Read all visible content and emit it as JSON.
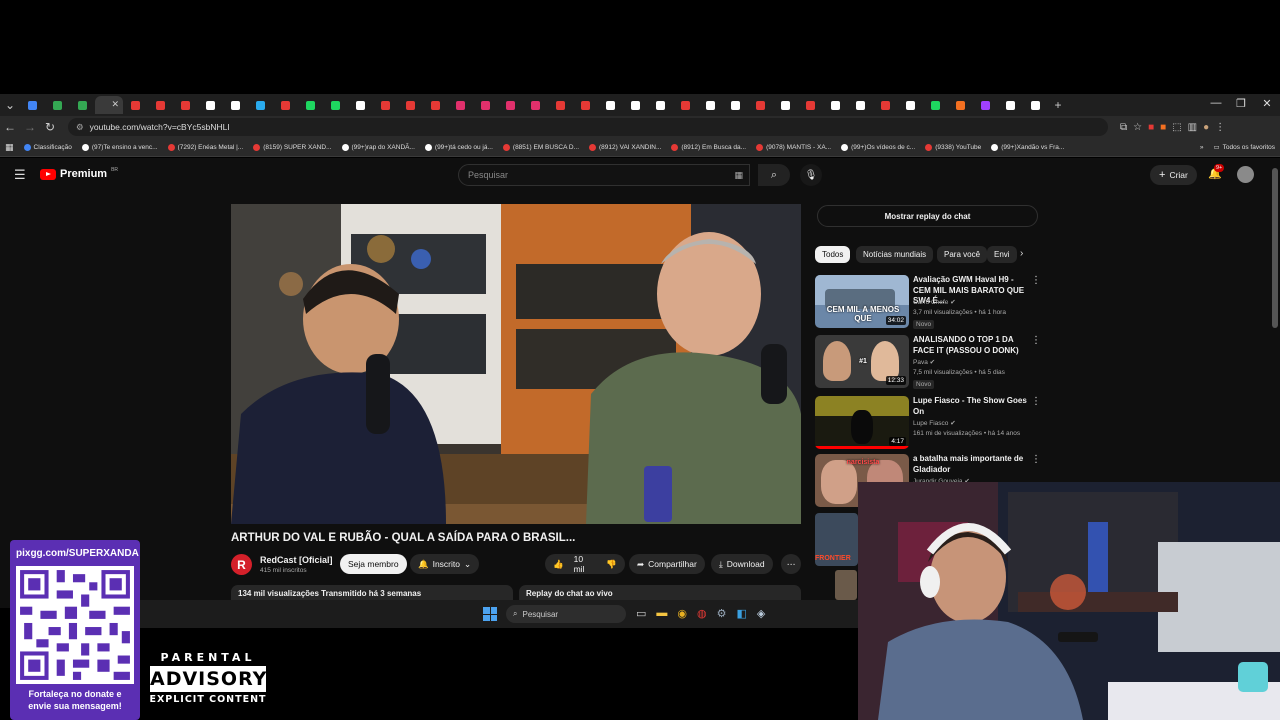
{
  "browser": {
    "url": "youtube.com/watch?v=cBYc5sbNHLI",
    "tab_colors": [
      "#4285f4",
      "#34a853",
      "#34a853",
      "#ffffff",
      "#e53935",
      "#e53935",
      "#e53935",
      "#ffffff",
      "#ffffff",
      "#2aabee",
      "#e53935",
      "#1ed760",
      "#1ed760",
      "#ffffff",
      "#e53935",
      "#e53935",
      "#e53935",
      "#e1306c",
      "#e1306c",
      "#e1306c",
      "#e1306c",
      "#e53935",
      "#e53935",
      "#ffffff",
      "#ffffff",
      "#ffffff",
      "#e53935",
      "#ffffff",
      "#ffffff",
      "#e53935",
      "#ffffff",
      "#e53935",
      "#ffffff",
      "#ffffff",
      "#e53935",
      "#ffffff",
      "#1ed760",
      "#f37021",
      "#a040ff",
      "#ffffff",
      "#ffffff"
    ],
    "bookmarks": [
      {
        "label": "Classificação",
        "color": "#4285f4"
      },
      {
        "label": "(97)Te ensino a venc...",
        "color": "#ffffff"
      },
      {
        "label": "(7292) Enéas Metal |...",
        "color": "#e53935"
      },
      {
        "label": "(8159) SUPER XAND...",
        "color": "#e53935"
      },
      {
        "label": "(99+)rap do XANDÃ...",
        "color": "#ffffff"
      },
      {
        "label": "(99+)tá cedo ou já...",
        "color": "#ffffff"
      },
      {
        "label": "(8851) EM BUSCA D...",
        "color": "#e53935"
      },
      {
        "label": "(8912) VAI XANDIN...",
        "color": "#e53935"
      },
      {
        "label": "(8912) Em Busca da...",
        "color": "#e53935"
      },
      {
        "label": "(9078) MANTIS - XA...",
        "color": "#e53935"
      },
      {
        "label": "(99+)Os vídeos de c...",
        "color": "#ffffff"
      },
      {
        "label": "(9338) YouTube",
        "color": "#e53935"
      },
      {
        "label": "(99+)Xandão vs Fra...",
        "color": "#ffffff"
      }
    ],
    "all_bookmarks": "Todos os favoritos"
  },
  "yt": {
    "logo": "Premium",
    "logo_badge": "BR",
    "search_placeholder": "Pesquisar",
    "create_label": "Criar",
    "notif_count": "9+",
    "video_title": "ARTHUR DO VAL E RUBÃO - QUAL A SAÍDA PARA O BRASIL...",
    "channel_initial": "R",
    "channel_name": "RedCast [Oficial]",
    "subscribers": "415 mil inscritos",
    "member_label": "Seja membro",
    "subscribed_label": "Inscrito",
    "likes": "10 mil",
    "share_label": "Compartilhar",
    "download_label": "Download",
    "views_info": "134 mil visualizações  Transmitido há 3 semanas",
    "chat_replay_card": "Replay do chat ao vivo",
    "chat_replay_button": "Mostrar replay do chat",
    "chips": [
      "Todos",
      "Notícias mundiais",
      "Para você",
      "Envi"
    ],
    "recs": [
      {
        "title": "Avaliação GWM Haval H9 - CEM MIL MAIS BARATO QUE SW4 É...",
        "channel": "Carro Chefe",
        "meta": "3,7 mil visualizações • há 1 hora",
        "badge": "Novo",
        "duration": "34:02",
        "thumb_text": "CEM MIL A MENOS QUE",
        "thumb_color": "#6b87a8"
      },
      {
        "title": "ANALISANDO O TOP 1 DA FACE IT (PASSOU O DONK)",
        "channel": "Pava",
        "meta": "7,5 mil visualizações • há 5 dias",
        "badge": "Novo",
        "duration": "12:33",
        "thumb_text": "#1",
        "thumb_color": "#3a3a3a"
      },
      {
        "title": "Lupe Fiasco - The Show Goes On",
        "channel": "Lupe Fiasco",
        "meta": "161 mi de visualizações • há 14 anos",
        "badge": "",
        "duration": "4:17",
        "thumb_text": "",
        "thumb_color": "#1a1a10"
      },
      {
        "title": "a batalha mais importante de Gladiador",
        "channel": "Jurandir Gouveia",
        "meta": "",
        "badge": "",
        "duration": "",
        "thumb_text": "narcisista",
        "thumb_color": "#7a5a48"
      }
    ],
    "frontier_text": "FRONTIER"
  },
  "taskbar": {
    "search_placeholder": "Pesquisar"
  },
  "overlay": {
    "qr_url": "pixgg.com/SUPERXANDA",
    "qr_message_1": "Fortaleça no donate e",
    "qr_message_2": "envie sua mensagem!",
    "pa_line1": "PARENTAL",
    "pa_line2": "ADVISORY",
    "pa_line3": "EXPLICIT CONTENT"
  },
  "colors": {
    "yt_bg": "#0f0f0f",
    "yt_red": "#ff0000",
    "accent_purple": "#5b2fb3",
    "chip_active": "#f1f1f1"
  }
}
